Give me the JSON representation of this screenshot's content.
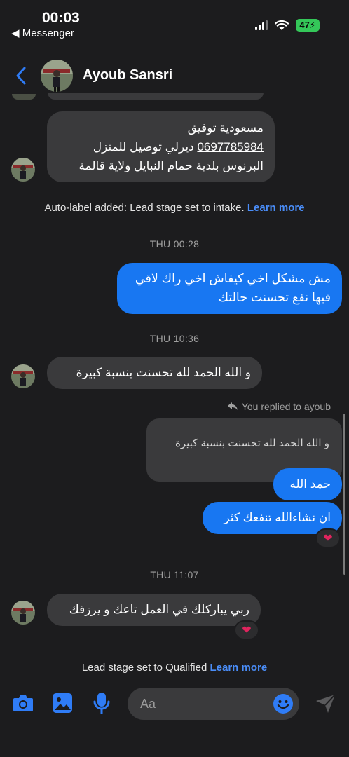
{
  "status_bar": {
    "time": "00:03",
    "back_app": "◀ Messenger",
    "battery": "47"
  },
  "header": {
    "contact_name": "Ayoub Sansri"
  },
  "messages": {
    "address_line1": "مسعودية توفيق",
    "address_line2_phone": "0697785984",
    "address_line2_text": " ديرلي توصيل للمنزل",
    "address_line3": "البرنوس بلدية حمام النبايل ولاية قالمة",
    "sys1_text": "Auto-label added: Lead stage set to intake.",
    "sys1_link": "Learn more",
    "time1": "THU 00:28",
    "out1_line1": "مش مشكل اخي كيفاش اخي راك لاقي",
    "out1_line2": "فيها نفع تحسنت حالتك",
    "time2": "THU 10:36",
    "in2": "و الله الحمد لله تحسنت بنسبة كبيرة",
    "replied_label": "You replied to ayoub",
    "quoted": "و الله الحمد لله تحسنت بنسبة كبيرة",
    "out2": "حمد الله",
    "out3": "ان نشاءالله تنفعك كثر",
    "reaction1": "❤",
    "time3": "THU 11:07",
    "in3": "ربي يباركلك في العمل تاعك و يرزقك",
    "reaction2": "❤",
    "sys2_text": "Lead stage set to Qualified",
    "sys2_link": "Learn more"
  },
  "composer": {
    "placeholder": "Aa"
  },
  "colors": {
    "background": "#1c1c1e",
    "incoming_bubble": "#3a3a3c",
    "outgoing_bubble": "#1877f2",
    "accent": "#1877f2",
    "link": "#4a8df8"
  }
}
